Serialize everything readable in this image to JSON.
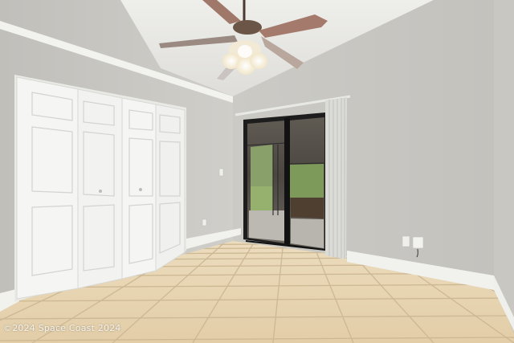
{
  "photo": {
    "subject": "Empty bedroom interior"
  },
  "watermark": {
    "text": "©2024 Space Coast 2024"
  },
  "colors": {
    "wall": "#c7c6c1",
    "ceiling": "#e9e8e4",
    "trim": "#f4f4f1",
    "floor_tile": "#e7d3b1",
    "grout": "#cdb894",
    "door_frame": "#1c1c1c",
    "curtain": "#dcdcd8",
    "fan_blade": "#a0786a"
  }
}
